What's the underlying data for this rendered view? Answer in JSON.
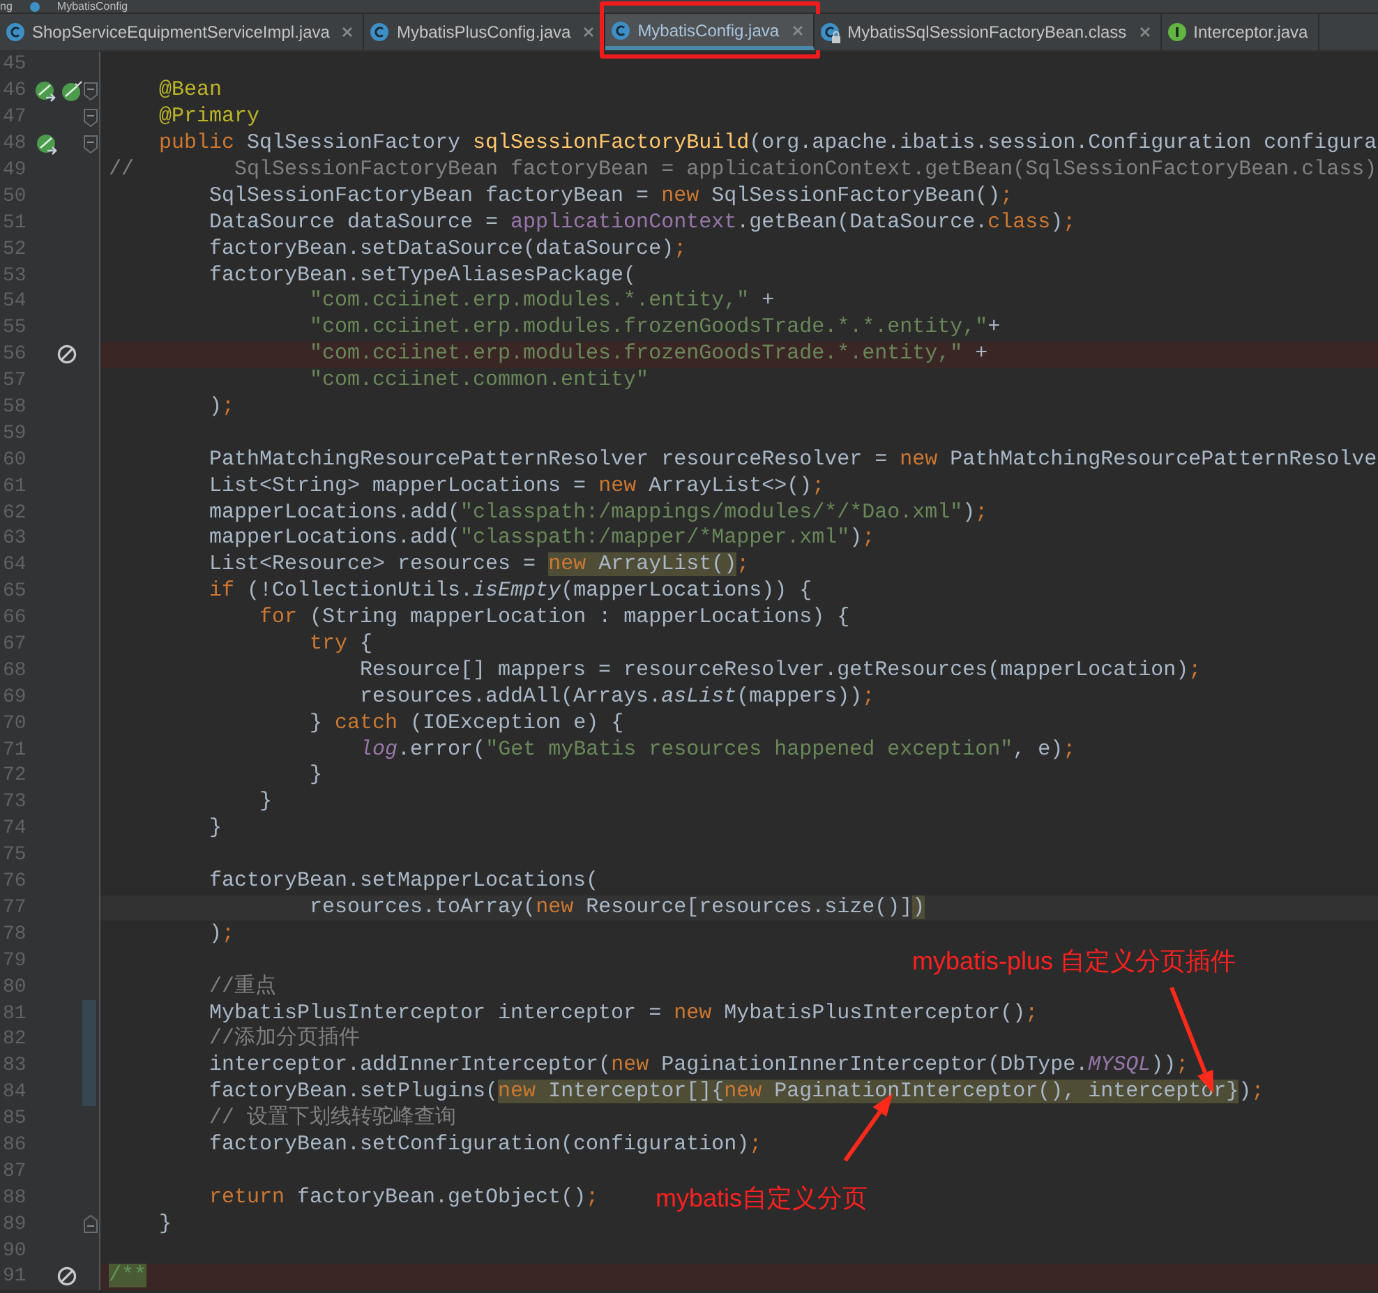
{
  "breadcrumb": [
    "ng",
    "MybatisConfig"
  ],
  "tabs": [
    {
      "label": "ShopServiceEquipmentServiceImpl.java",
      "kind": "class",
      "selected": false,
      "closable": true,
      "framed": false
    },
    {
      "label": "MybatisPlusConfig.java",
      "kind": "class",
      "selected": false,
      "closable": true,
      "framed": false
    },
    {
      "label": "MybatisConfig.java",
      "kind": "class",
      "selected": true,
      "closable": true,
      "framed": true
    },
    {
      "label": "MybatisSqlSessionFactoryBean.class",
      "kind": "readonly",
      "selected": false,
      "closable": true,
      "framed": false
    },
    {
      "label": "Interceptor.java",
      "kind": "interface",
      "selected": false,
      "closable": false,
      "framed": false
    }
  ],
  "lines": [
    {
      "number": "45",
      "kind": "normal"
    },
    {
      "number": "46",
      "kind": "normal",
      "gutter": [
        {
          "kind": "bean-nav"
        },
        {
          "kind": "bean-check"
        },
        {
          "kind": "fold-open"
        }
      ],
      "code": [
        {
          "text": "    @Bean",
          "kind": "annotation"
        }
      ]
    },
    {
      "number": "47",
      "kind": "normal",
      "gutter": [
        {
          "kind": "fold-open"
        }
      ],
      "code": [
        {
          "text": "    @Primary",
          "kind": "annotation"
        }
      ]
    },
    {
      "number": "48",
      "kind": "normal",
      "gutter": [
        {
          "kind": "bean-nav"
        },
        {
          "kind": "fold-open"
        }
      ],
      "code": [
        {
          "text": "    public",
          "kind": "keyword"
        },
        {
          "text": " SqlSessionFactory ",
          "kind": "plain"
        },
        {
          "text": "sqlSessionFactoryBuild",
          "kind": "method"
        },
        {
          "text": "(org.apache.ibatis.session.Configuration configura",
          "kind": "plain"
        }
      ]
    },
    {
      "number": "49",
      "kind": "normal",
      "code": [
        {
          "text": "//        SqlSessionFactoryBean factoryBean = applicationContext.getBean(SqlSessionFactoryBean.class)",
          "kind": "comment"
        }
      ]
    },
    {
      "number": "50",
      "kind": "normal",
      "code": [
        {
          "text": "        SqlSessionFactoryBean factoryBean = ",
          "kind": "plain"
        },
        {
          "text": "new",
          "kind": "keyword"
        },
        {
          "text": " SqlSessionFactoryBean()",
          "kind": "plain"
        },
        {
          "text": ";",
          "kind": "keyword"
        }
      ]
    },
    {
      "number": "51",
      "kind": "normal",
      "code": [
        {
          "text": "        DataSource dataSource = ",
          "kind": "plain"
        },
        {
          "text": "applicationContext",
          "kind": "field"
        },
        {
          "text": ".getBean(DataSource.",
          "kind": "plain"
        },
        {
          "text": "class",
          "kind": "keyword"
        },
        {
          "text": ")",
          "kind": "plain"
        },
        {
          "text": ";",
          "kind": "keyword"
        }
      ]
    },
    {
      "number": "52",
      "kind": "normal",
      "code": [
        {
          "text": "        factoryBean.setDataSource(dataSource)",
          "kind": "plain"
        },
        {
          "text": ";",
          "kind": "keyword"
        }
      ]
    },
    {
      "number": "53",
      "kind": "normal",
      "code": [
        {
          "text": "        factoryBean.setTypeAliasesPackage(",
          "kind": "plain"
        }
      ]
    },
    {
      "number": "54",
      "kind": "normal",
      "code": [
        {
          "text": "                \"com.cciinet.erp.modules.*.entity,\"",
          "kind": "string"
        },
        {
          "text": " +",
          "kind": "plain"
        }
      ]
    },
    {
      "number": "55",
      "kind": "normal",
      "code": [
        {
          "text": "                \"com.cciinet.erp.modules.frozenGoodsTrade.*.*.entity,\"",
          "kind": "string"
        },
        {
          "text": "+",
          "kind": "plain"
        }
      ]
    },
    {
      "number": "56",
      "kind": "breakpoint",
      "code": [
        {
          "text": "                \"com.cciinet.erp.modules.frozenGoodsTrade.*.entity,\"",
          "kind": "string"
        },
        {
          "text": " +",
          "kind": "plain"
        }
      ]
    },
    {
      "number": "57",
      "kind": "normal",
      "code": [
        {
          "text": "                \"com.cciinet.common.entity\"",
          "kind": "string"
        }
      ]
    },
    {
      "number": "58",
      "kind": "normal",
      "code": [
        {
          "text": "        )",
          "kind": "plain"
        },
        {
          "text": ";",
          "kind": "keyword"
        }
      ]
    },
    {
      "number": "59",
      "kind": "normal"
    },
    {
      "number": "60",
      "kind": "normal",
      "code": [
        {
          "text": "        PathMatchingResourcePatternResolver resourceResolver = ",
          "kind": "plain"
        },
        {
          "text": "new",
          "kind": "keyword"
        },
        {
          "text": " PathMatchingResourcePatternResolve",
          "kind": "plain"
        }
      ]
    },
    {
      "number": "61",
      "kind": "normal",
      "code": [
        {
          "text": "        List<String> mapperLocations = ",
          "kind": "plain"
        },
        {
          "text": "new",
          "kind": "keyword"
        },
        {
          "text": " ArrayList<>()",
          "kind": "plain"
        },
        {
          "text": ";",
          "kind": "keyword"
        }
      ]
    },
    {
      "number": "62",
      "kind": "normal",
      "code": [
        {
          "text": "        mapperLocations.add(",
          "kind": "plain"
        },
        {
          "text": "\"classpath:/mappings/modules/*/*Dao.xml\"",
          "kind": "string"
        },
        {
          "text": ")",
          "kind": "plain"
        },
        {
          "text": ";",
          "kind": "keyword"
        }
      ]
    },
    {
      "number": "63",
      "kind": "normal",
      "code": [
        {
          "text": "        mapperLocations.add(",
          "kind": "plain"
        },
        {
          "text": "\"classpath:/mapper/*Mapper.xml\"",
          "kind": "string"
        },
        {
          "text": ")",
          "kind": "plain"
        },
        {
          "text": ";",
          "kind": "keyword"
        }
      ]
    },
    {
      "number": "64",
      "kind": "normal",
      "code": [
        {
          "text": "        List<Resource> resources = ",
          "kind": "plain"
        },
        {
          "text": "new",
          "kind": "markedkw"
        },
        {
          "text": " ArrayList()",
          "kind": "marked"
        },
        {
          "text": ";",
          "kind": "keyword"
        }
      ]
    },
    {
      "number": "65",
      "kind": "normal",
      "code": [
        {
          "text": "        if",
          "kind": "keyword"
        },
        {
          "text": " (!CollectionUtils.",
          "kind": "plain"
        },
        {
          "text": "isEmpty",
          "kind": "static"
        },
        {
          "text": "(mapperLocations)) {",
          "kind": "plain"
        }
      ]
    },
    {
      "number": "66",
      "kind": "normal",
      "code": [
        {
          "text": "            for",
          "kind": "keyword"
        },
        {
          "text": " (String mapperLocation : mapperLocations) {",
          "kind": "plain"
        }
      ]
    },
    {
      "number": "67",
      "kind": "normal",
      "code": [
        {
          "text": "                try",
          "kind": "keyword"
        },
        {
          "text": " {",
          "kind": "plain"
        }
      ]
    },
    {
      "number": "68",
      "kind": "normal",
      "code": [
        {
          "text": "                    Resource[] mappers = resourceResolver.getResources(mapperLocation)",
          "kind": "plain"
        },
        {
          "text": ";",
          "kind": "keyword"
        }
      ]
    },
    {
      "number": "69",
      "kind": "normal",
      "code": [
        {
          "text": "                    resources.addAll(Arrays.",
          "kind": "plain"
        },
        {
          "text": "asList",
          "kind": "static"
        },
        {
          "text": "(mappers))",
          "kind": "plain"
        },
        {
          "text": ";",
          "kind": "keyword"
        }
      ]
    },
    {
      "number": "70",
      "kind": "normal",
      "code": [
        {
          "text": "                } ",
          "kind": "plain"
        },
        {
          "text": "catch",
          "kind": "keyword"
        },
        {
          "text": " (IOException e) {",
          "kind": "plain"
        }
      ]
    },
    {
      "number": "71",
      "kind": "normal",
      "code": [
        {
          "text": "                    log",
          "kind": "staticfield"
        },
        {
          "text": ".error(",
          "kind": "plain"
        },
        {
          "text": "\"Get myBatis resources happened exception\"",
          "kind": "string"
        },
        {
          "text": ", e)",
          "kind": "plain"
        },
        {
          "text": ";",
          "kind": "keyword"
        }
      ]
    },
    {
      "number": "72",
      "kind": "normal",
      "code": [
        {
          "text": "                }",
          "kind": "plain"
        }
      ]
    },
    {
      "number": "73",
      "kind": "normal",
      "code": [
        {
          "text": "            }",
          "kind": "plain"
        }
      ]
    },
    {
      "number": "74",
      "kind": "normal",
      "code": [
        {
          "text": "        }",
          "kind": "plain"
        }
      ]
    },
    {
      "number": "75",
      "kind": "normal"
    },
    {
      "number": "76",
      "kind": "normal",
      "code": [
        {
          "text": "        factoryBean.setMapperLocations(",
          "kind": "plain"
        }
      ]
    },
    {
      "number": "77",
      "kind": "current",
      "code": [
        {
          "text": "                resources.toArray(",
          "kind": "plain"
        },
        {
          "text": "new",
          "kind": "keyword"
        },
        {
          "text": " Resource[resources.size()]",
          "kind": "plain"
        },
        {
          "text": ")",
          "kind": "marked"
        }
      ]
    },
    {
      "number": "78",
      "kind": "normal",
      "code": [
        {
          "text": "        )",
          "kind": "plain"
        },
        {
          "text": ";",
          "kind": "keyword"
        }
      ]
    },
    {
      "number": "79",
      "kind": "normal"
    },
    {
      "number": "80",
      "kind": "normal",
      "code": [
        {
          "text": "        //重点",
          "kind": "comment"
        }
      ]
    },
    {
      "number": "81",
      "kind": "normal",
      "gutter": [
        {
          "kind": "changed"
        }
      ],
      "code": [
        {
          "text": "        MybatisPlusInterceptor interceptor = ",
          "kind": "plain"
        },
        {
          "text": "new",
          "kind": "keyword"
        },
        {
          "text": " MybatisPlusInterceptor()",
          "kind": "plain"
        },
        {
          "text": ";",
          "kind": "keyword"
        }
      ]
    },
    {
      "number": "82",
      "kind": "normal",
      "gutter": [
        {
          "kind": "changed"
        }
      ],
      "code": [
        {
          "text": "        //添加分页插件",
          "kind": "comment"
        }
      ]
    },
    {
      "number": "83",
      "kind": "normal",
      "gutter": [
        {
          "kind": "changed"
        }
      ],
      "code": [
        {
          "text": "        interceptor.addInnerInterceptor(",
          "kind": "plain"
        },
        {
          "text": "new",
          "kind": "keyword"
        },
        {
          "text": " PaginationInnerInterceptor(DbType.",
          "kind": "plain"
        },
        {
          "text": "MYSQL",
          "kind": "staticfield"
        },
        {
          "text": "))",
          "kind": "plain"
        },
        {
          "text": ";",
          "kind": "keyword"
        }
      ]
    },
    {
      "number": "84",
      "kind": "normal",
      "gutter": [
        {
          "kind": "changed"
        }
      ],
      "code": [
        {
          "text": "        factoryBean.setPlugins(",
          "kind": "plain"
        },
        {
          "text": "new",
          "kind": "markedkw"
        },
        {
          "text": " Interceptor[]{",
          "kind": "marked"
        },
        {
          "text": "new",
          "kind": "markedkw"
        },
        {
          "text": " PaginationInterceptor(), interceptor}",
          "kind": "marked"
        },
        {
          "text": ")",
          "kind": "plain"
        },
        {
          "text": ";",
          "kind": "keyword"
        }
      ]
    },
    {
      "number": "85",
      "kind": "normal",
      "code": [
        {
          "text": "        // 设置下划线转驼峰查询",
          "kind": "comment"
        }
      ]
    },
    {
      "number": "86",
      "kind": "normal",
      "code": [
        {
          "text": "        factoryBean.setConfiguration(configuration)",
          "kind": "plain"
        },
        {
          "text": ";",
          "kind": "keyword"
        }
      ]
    },
    {
      "number": "87",
      "kind": "normal"
    },
    {
      "number": "88",
      "kind": "normal",
      "code": [
        {
          "text": "        return",
          "kind": "keyword"
        },
        {
          "text": " factoryBean.getObject()",
          "kind": "plain"
        },
        {
          "text": ";",
          "kind": "keyword"
        }
      ]
    },
    {
      "number": "89",
      "kind": "normal",
      "gutter": [
        {
          "kind": "fold-end"
        }
      ],
      "code": [
        {
          "text": "    }",
          "kind": "plain"
        }
      ]
    },
    {
      "number": "90",
      "kind": "normal"
    },
    {
      "number": "91",
      "kind": "breakpoint",
      "code": [
        {
          "text": "/**",
          "kind": "doc"
        }
      ]
    }
  ],
  "annotations": [
    {
      "text": "mybatis-plus 自定义分页插件"
    },
    {
      "text": "mybatis自定义分页"
    }
  ]
}
